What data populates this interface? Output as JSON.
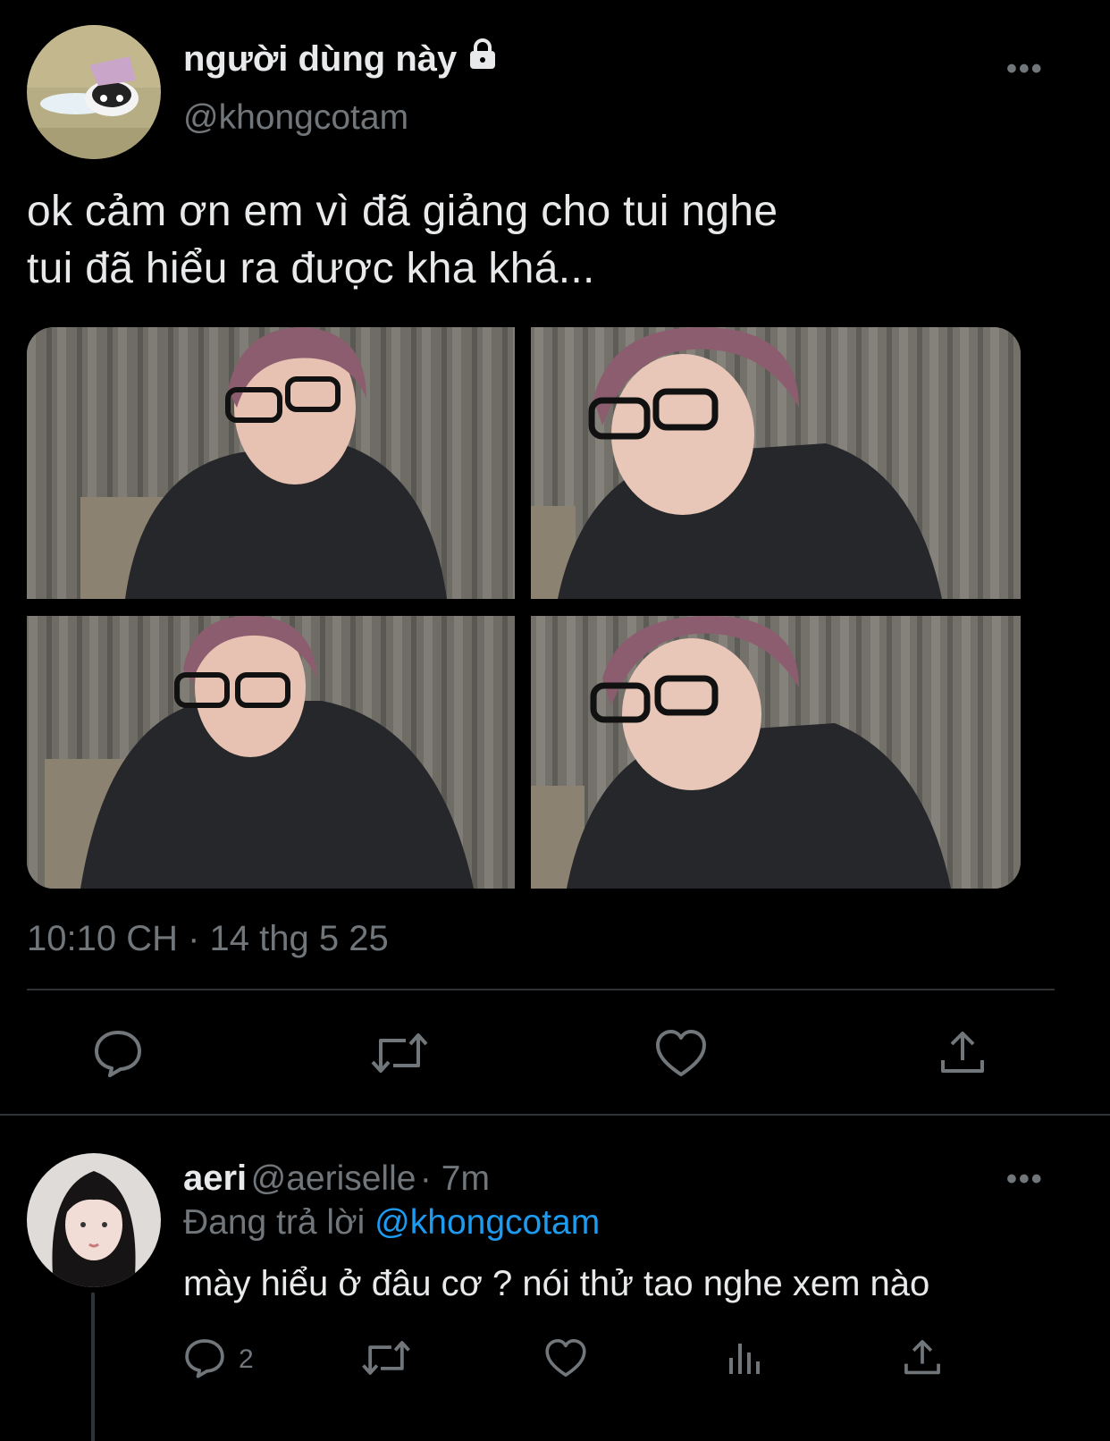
{
  "tweet": {
    "display_name": "người dùng này",
    "handle": "@khongcotam",
    "text_line1": "ok cảm ơn em vì đã giảng cho tui nghe",
    "text_line2": "tui đã hiểu ra được kha khá...",
    "timestamp": "10:10 CH · 14 thg 5 25",
    "more_label": "•••",
    "photos": [
      "photo-1",
      "photo-2",
      "photo-3",
      "photo-4"
    ]
  },
  "reply": {
    "display_name": "aeri",
    "handle": "@aeriselle",
    "separator": " · ",
    "age": "7m",
    "replying_to_prefix": "Đang trả lời ",
    "replying_to_handle": "@khongcotam",
    "text": "mày hiểu ở đâu cơ ? nói thử tao nghe xem nào",
    "reply_count": "2",
    "more_label": "•••"
  },
  "colors": {
    "background": "#000000",
    "text": "#e7e9ea",
    "secondary": "#71767b",
    "accent": "#1d9bf0",
    "divider": "#2f3336"
  },
  "icons": [
    "lock-icon",
    "more-icon",
    "reply-icon",
    "retweet-icon",
    "like-icon",
    "share-icon",
    "views-icon"
  ]
}
